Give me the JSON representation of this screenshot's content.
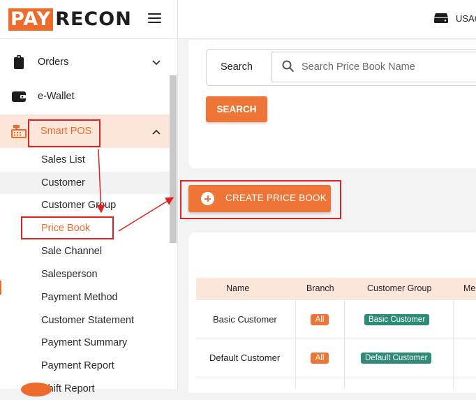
{
  "brand": {
    "part1": "PAY",
    "part2": "RECON"
  },
  "user": {
    "label": "USAG"
  },
  "sidebar": {
    "items": [
      {
        "label": "Orders"
      },
      {
        "label": "e-Wallet"
      },
      {
        "label": "Smart POS"
      }
    ],
    "sub_items": [
      {
        "label": "Sales List"
      },
      {
        "label": "Customer"
      },
      {
        "label": "Customer Group"
      },
      {
        "label": "Price Book"
      },
      {
        "label": "Sale Channel"
      },
      {
        "label": "Salesperson"
      },
      {
        "label": "Payment Method"
      },
      {
        "label": "Customer Statement"
      },
      {
        "label": "Payment Summary"
      },
      {
        "label": "Payment Report"
      },
      {
        "label": "Shift Report"
      }
    ]
  },
  "search": {
    "label": "Search",
    "placeholder": "Search Price Book Name",
    "button": "SEARCH"
  },
  "create_button": "CREATE PRICE BOOK",
  "table": {
    "headers": [
      "Name",
      "Branch",
      "Customer Group",
      "Me"
    ],
    "rows": [
      {
        "name": "Basic Customer",
        "branch": "All",
        "group": "Basic Customer"
      },
      {
        "name": "Default Customer",
        "branch": "All",
        "group": "Default Customer"
      }
    ]
  },
  "colors": {
    "accent": "#ee6b2c",
    "highlight": "#fde7da",
    "group_badge": "#2e8b78",
    "annotation": "#e02121"
  }
}
